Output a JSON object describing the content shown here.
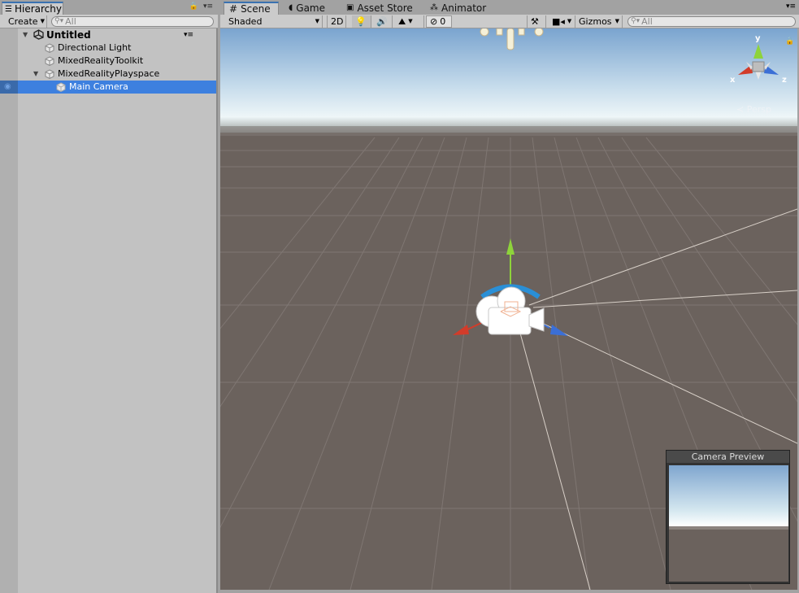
{
  "hierarchy": {
    "tab_label": "Hierarchy",
    "create_label": "Create",
    "search_placeholder": "All",
    "scene_name": "Untitled",
    "items": [
      {
        "label": "Directional Light"
      },
      {
        "label": "MixedRealityToolkit"
      },
      {
        "label": "MixedRealityPlayspace"
      },
      {
        "label": "Main Camera"
      }
    ]
  },
  "scene_tabs": [
    {
      "label": "Scene",
      "icon": "hash-icon"
    },
    {
      "label": "Game",
      "icon": "pacman-icon"
    },
    {
      "label": "Asset Store",
      "icon": "bag-icon"
    },
    {
      "label": "Animator",
      "icon": "nodes-icon"
    }
  ],
  "scene_toolbar": {
    "shading": "Shaded",
    "mode_2d": "2D",
    "hidden_count": "0",
    "gizmos": "Gizmos",
    "search_placeholder": "All"
  },
  "orientation_gizmo": {
    "y_label": "y",
    "x_label": "x",
    "z_label": "z",
    "projection": "Persp"
  },
  "camera_preview": {
    "title": "Camera Preview"
  },
  "colors": {
    "selection": "#3d80df",
    "ground": "#6b625d",
    "sky_top": "#7aa4cf",
    "horizon": "#eef6f8",
    "axis_x": "#d23c2a",
    "axis_y": "#8ed33b",
    "axis_z": "#3b6fd6"
  }
}
